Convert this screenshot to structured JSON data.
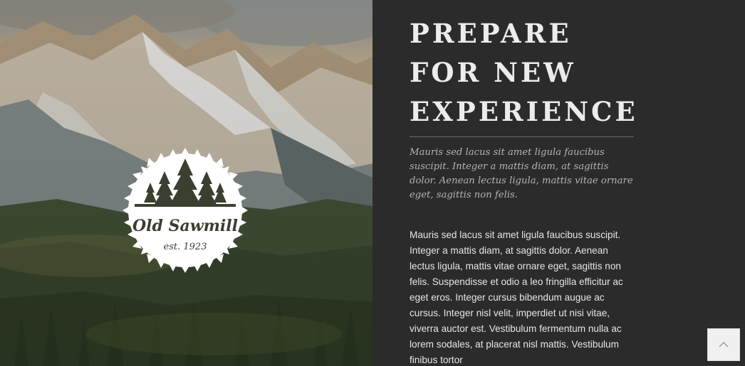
{
  "hero": {
    "logo": {
      "name": "Old Sawmill",
      "tagline": "est. 1923"
    }
  },
  "content": {
    "headline": [
      "PREPARE",
      "FOR NEW",
      "EXPERIENCE"
    ],
    "lead": "Mauris sed lacus sit amet ligula faucibus suscipit. Integer a mattis diam, at sagittis dolor. Aenean lectus ligula, mattis vitae ornare eget, sagittis non felis.",
    "body": "Mauris sed lacus sit amet ligula faucibus suscipit. Integer a mattis diam, at sagittis dolor. Aenean lectus ligula, mattis vitae ornare eget, sagittis non felis. Suspendisse et odio a leo fringilla efficitur ac eget eros. Integer cursus bibendum augue ac cursus. Integer nisl velit, imperdiet ut nisi vitae, viverra auctor est. Vestibulum fermentum nulla ac lorem sodales, at placerat nisl mattis. Vestibulum finibus tortor"
  },
  "scroll_top": {
    "icon": "chevron-up-icon"
  },
  "colors": {
    "panel_background": "#2b2b2b",
    "headline": "#ececec",
    "lead": "#b4b4b4",
    "body": "#e6e6e6",
    "button_background": "#f0f0f0"
  }
}
